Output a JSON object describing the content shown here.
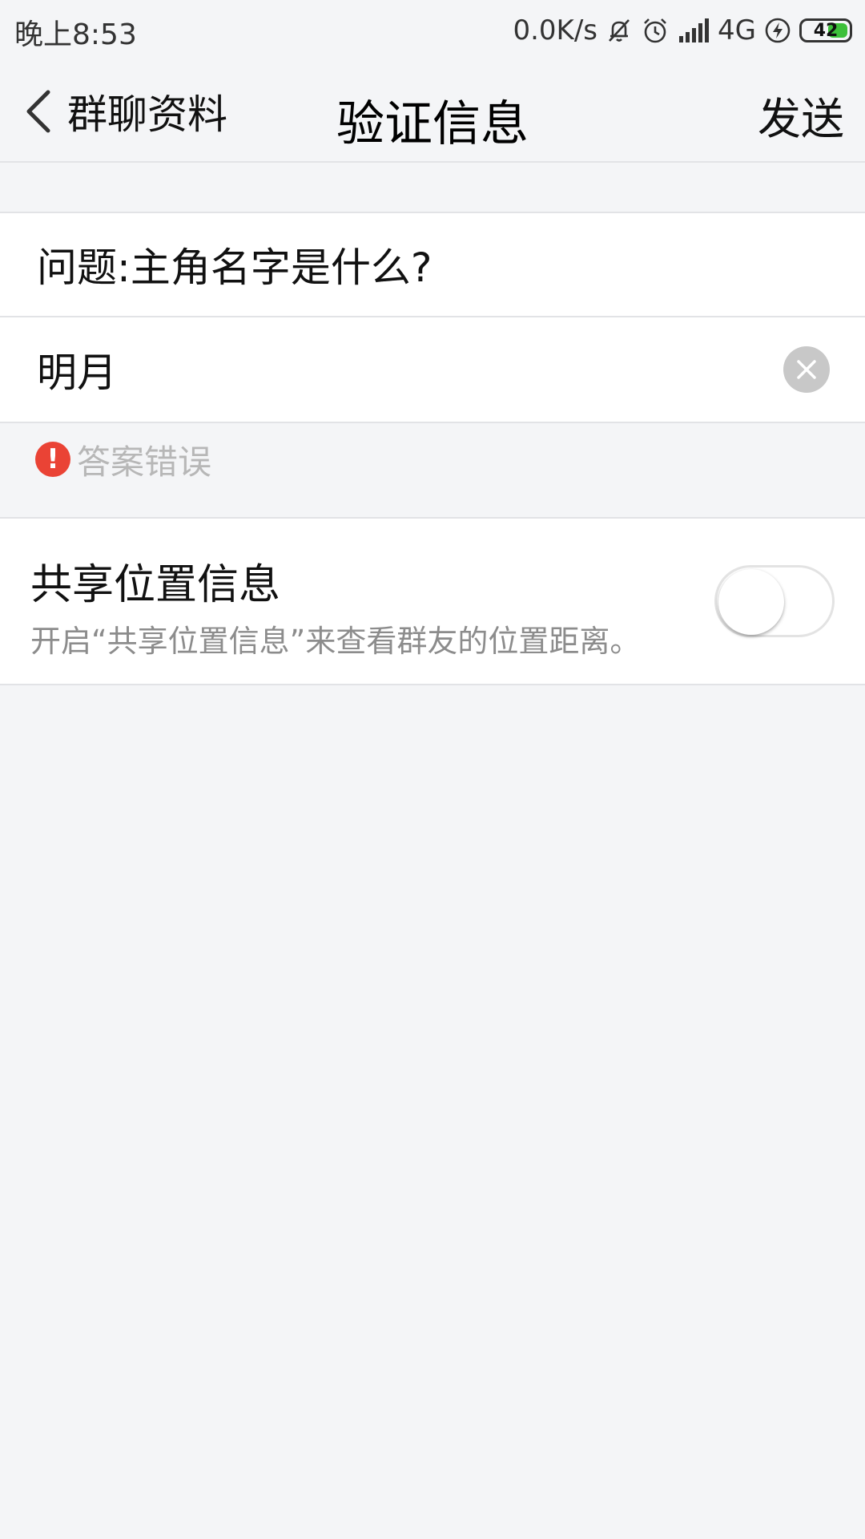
{
  "status_bar": {
    "time": "晚上8:53",
    "network_speed": "0.0K/s",
    "network_type": "4G",
    "battery_level": "42",
    "icons": [
      "mute-icon",
      "alarm-icon",
      "signal-icon",
      "charging-icon",
      "battery-icon"
    ]
  },
  "nav": {
    "back_label": "群聊资料",
    "title": "验证信息",
    "send_label": "发送"
  },
  "form": {
    "question": "问题:主角名字是什么?",
    "answer_value": "明月",
    "error_text": "答案错误",
    "error_color": "#ea4335"
  },
  "share_location": {
    "title": "共享位置信息",
    "description": "开启“共享位置信息”来查看群友的位置距离。",
    "enabled": false
  }
}
